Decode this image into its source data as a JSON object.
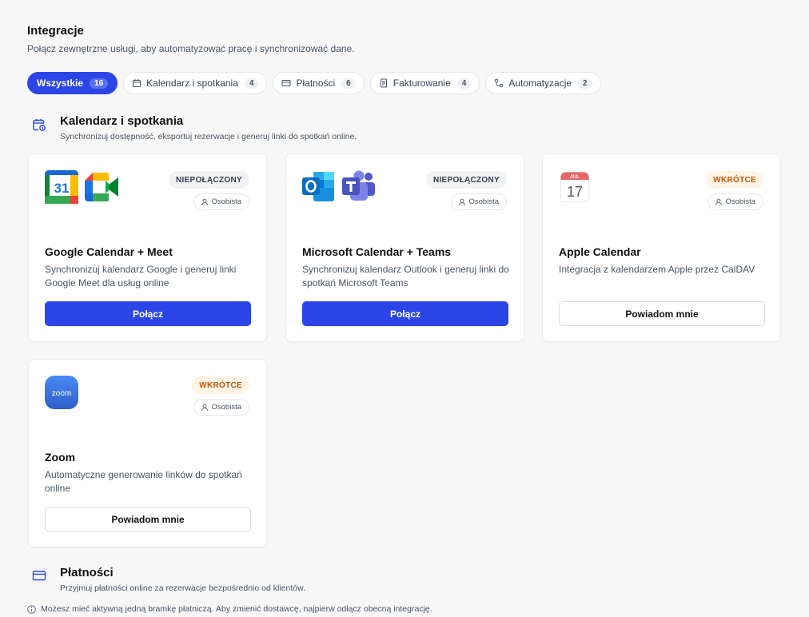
{
  "header": {
    "title": "Integracje",
    "subtitle": "Połącz zewnętrzne usługi, aby automatyzować pracę i synchronizować dane."
  },
  "tabs": [
    {
      "label": "Wszystkie",
      "count": "16",
      "icon": "none",
      "active": true
    },
    {
      "label": "Kalendarz i spotkania",
      "count": "4",
      "icon": "calendar-icon",
      "active": false
    },
    {
      "label": "Płatności",
      "count": "6",
      "icon": "credit-card-icon",
      "active": false
    },
    {
      "label": "Fakturowanie",
      "count": "4",
      "icon": "receipt-icon",
      "active": false
    },
    {
      "label": "Automatyzacje",
      "count": "2",
      "icon": "workflow-icon",
      "active": false
    }
  ],
  "sections": {
    "calendar": {
      "title": "Kalendarz i spotkania",
      "description": "Synchronizuj dostępność, eksportuj rezerwacje i generuj linki do spotkań online."
    },
    "payments": {
      "title": "Płatności",
      "description": "Przyjmuj płatności online za rezerwacje bezpośrednio od klientów."
    }
  },
  "cards": [
    {
      "title": "Google Calendar + Meet",
      "description": "Synchronizuj kalendarz Google i generuj linki Google Meet dla usług online",
      "status": "NIEPOŁĄCZONY",
      "scope": "Osobista",
      "button": "Połącz",
      "logos": [
        "google-calendar-logo",
        "google-meet-logo"
      ],
      "logo_text": "31"
    },
    {
      "title": "Microsoft Calendar + Teams",
      "description": "Synchronizuj kalendarz Outlook i generuj linki do spotkań Microsoft Teams",
      "status": "NIEPOŁĄCZONY",
      "scope": "Osobista",
      "button": "Połącz",
      "logos": [
        "outlook-logo",
        "teams-logo"
      ]
    },
    {
      "title": "Apple Calendar",
      "description": "Integracja z kalendarzem Apple przez CalDAV",
      "status": "WKRÓTCE",
      "scope": "Osobista",
      "button": "Powiadom mnie",
      "logos": [
        "apple-calendar-logo"
      ],
      "logo_month": "JUL",
      "logo_day": "17"
    },
    {
      "title": "Zoom",
      "description": "Automatyczne generowanie linków do spotkań online",
      "status": "WKRÓTCE",
      "scope": "Osobista",
      "button": "Powiadom mnie",
      "logos": [
        "zoom-logo"
      ],
      "logo_text": "zoom"
    }
  ],
  "notice": "Możesz mieć aktywną jedną bramkę płatniczą. Aby zmienić dostawcę, najpierw odłącz obecną integrację.",
  "colors": {
    "accent": "#2b45e6",
    "status_warning": "#c2540a"
  }
}
